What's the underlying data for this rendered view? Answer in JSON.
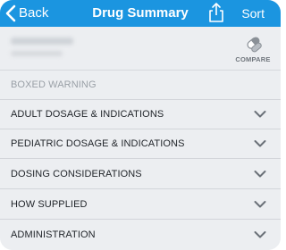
{
  "navbar": {
    "back_label": "Back",
    "title": "Drug Summary",
    "share_icon": "share-icon",
    "sort_label": "Sort",
    "color": "#1b95e0"
  },
  "drug": {
    "compare_label": "COMPARE",
    "compare_icon": "pill-compare-icon"
  },
  "sections": [
    {
      "label": "BOXED WARNING",
      "enabled": false
    },
    {
      "label": "ADULT DOSAGE & INDICATIONS",
      "enabled": true
    },
    {
      "label": "PEDIATRIC DOSAGE & INDICATIONS",
      "enabled": true
    },
    {
      "label": "DOSING CONSIDERATIONS",
      "enabled": true
    },
    {
      "label": "HOW SUPPLIED",
      "enabled": true
    },
    {
      "label": "ADMINISTRATION",
      "enabled": true
    }
  ]
}
